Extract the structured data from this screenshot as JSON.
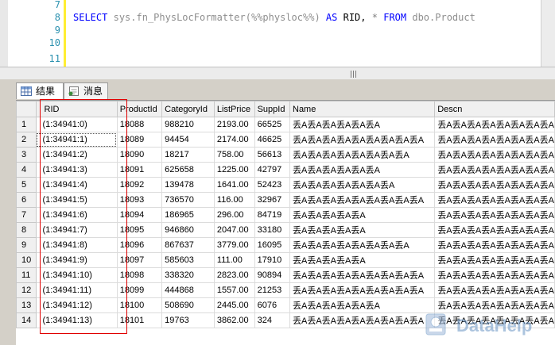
{
  "editor": {
    "line_numbers": [
      "7",
      "8",
      "9",
      "10",
      "11"
    ],
    "sql": {
      "kw_select": "SELECT",
      "fn_call": "sys.fn_PhysLocFormatter(%%physloc%%)",
      "kw_as": "AS",
      "rid_alias": "RID,",
      "star": "*",
      "kw_from": "FROM",
      "table": "dbo.Product"
    }
  },
  "tabs": [
    {
      "label": "结果",
      "icon": "grid-icon"
    },
    {
      "label": "消息",
      "icon": "messages-icon"
    }
  ],
  "grid": {
    "columns": [
      "",
      "RID",
      "ProductId",
      "CategoryId",
      "ListPrice",
      "SuppId",
      "Name",
      "Descn"
    ],
    "rows": [
      [
        "1",
        "(1:34941:0)",
        "18088",
        "988210",
        "2193.00",
        "66525",
        "丢A丢A丢A丢A丢A丢A",
        "丢A丢A丢A丢A丢A丢A丢A丢A"
      ],
      [
        "2",
        "(1:34941:1)",
        "18089",
        "94454",
        "2174.00",
        "46625",
        "丢A丢A丢A丢A丢A丢A丢A丢A丢A",
        "丢A丢A丢A丢A丢A丢A丢A丢A"
      ],
      [
        "3",
        "(1:34941:2)",
        "18090",
        "18217",
        "758.00",
        "56613",
        "丢A丢A丢A丢A丢A丢A丢A丢A",
        "丢A丢A丢A丢A丢A丢A丢A丢A"
      ],
      [
        "4",
        "(1:34941:3)",
        "18091",
        "625658",
        "1225.00",
        "42797",
        "丢A丢A丢A丢A丢A丢A",
        "丢A丢A丢A丢A丢A丢A丢A丢A"
      ],
      [
        "5",
        "(1:34941:4)",
        "18092",
        "139478",
        "1641.00",
        "52423",
        "丢A丢A丢A丢A丢A丢A丢A",
        "丢A丢A丢A丢A丢A丢A丢A丢A"
      ],
      [
        "6",
        "(1:34941:5)",
        "18093",
        "736570",
        "116.00",
        "32967",
        "丢A丢A丢A丢A丢A丢A丢A丢A丢A",
        "丢A丢A丢A丢A丢A丢A丢A丢A"
      ],
      [
        "7",
        "(1:34941:6)",
        "18094",
        "186965",
        "296.00",
        "84719",
        "丢A丢A丢A丢A丢A",
        "丢A丢A丢A丢A丢A丢A丢A丢A"
      ],
      [
        "8",
        "(1:34941:7)",
        "18095",
        "946860",
        "2047.00",
        "33180",
        "丢A丢A丢A丢A丢A",
        "丢A丢A丢A丢A丢A丢A丢A丢A"
      ],
      [
        "9",
        "(1:34941:8)",
        "18096",
        "867637",
        "3779.00",
        "16095",
        "丢A丢A丢A丢A丢A丢A丢A丢A",
        "丢A丢A丢A丢A丢A丢A丢A丢A"
      ],
      [
        "10",
        "(1:34941:9)",
        "18097",
        "585603",
        "111.00",
        "17910",
        "丢A丢A丢A丢A丢A",
        "丢A丢A丢A丢A丢A丢A丢A丢A"
      ],
      [
        "11",
        "(1:34941:10)",
        "18098",
        "338320",
        "2823.00",
        "90894",
        "丢A丢A丢A丢A丢A丢A丢A丢A丢A",
        "丢A丢A丢A丢A丢A丢A丢A丢A"
      ],
      [
        "12",
        "(1:34941:11)",
        "18099",
        "444868",
        "1557.00",
        "21253",
        "丢A丢A丢A丢A丢A丢A丢A丢A丢A",
        "丢A丢A丢A丢A丢A丢A丢A丢A"
      ],
      [
        "13",
        "(1:34941:12)",
        "18100",
        "508690",
        "2445.00",
        "6076",
        "丢A丢A丢A丢A丢A丢A",
        "丢A丢A丢A丢A丢A丢A丢A丢A"
      ],
      [
        "14",
        "(1:34941:13)",
        "18101",
        "19763",
        "3862.00",
        "324",
        "丢A丢A丢A丢A丢A丢A丢A丢A丢A",
        "丢A丢A丢A丢A丢A丢A丢A丢A"
      ]
    ]
  },
  "watermark": {
    "text": "DataHelp"
  },
  "colors": {
    "highlight_box": "#e00000",
    "keyword": "#0000ff",
    "line_number": "#2b91af"
  }
}
